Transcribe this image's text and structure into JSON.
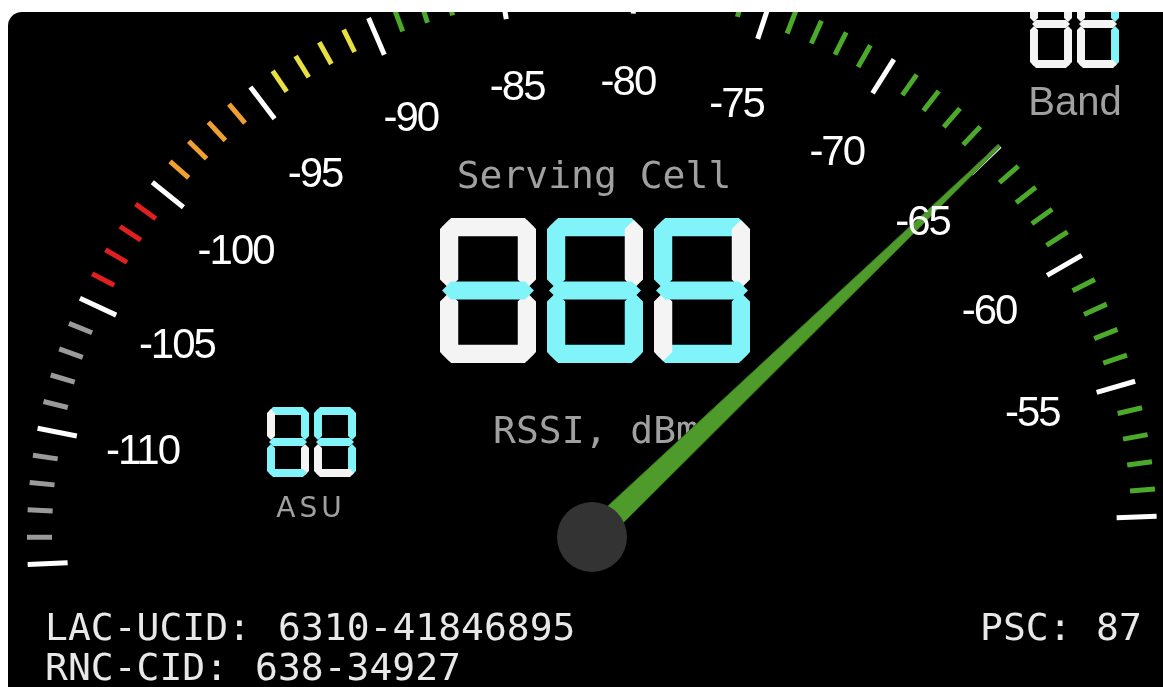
{
  "gauge": {
    "scale_labels": [
      "-110",
      "-105",
      "-100",
      "-95",
      "-90",
      "-85",
      "-80",
      "-75",
      "-70",
      "-65",
      "-60",
      "-55"
    ],
    "needle": {
      "level": 0.769
    }
  },
  "serving_cell": {
    "title": "Serving Cell",
    "digits": [
      {
        "segments": {
          "a": false,
          "b": false,
          "c": false,
          "d": false,
          "e": false,
          "f": false,
          "g": true
        }
      },
      {
        "segments": {
          "a": true,
          "b": false,
          "c": true,
          "d": true,
          "e": true,
          "f": true,
          "g": true
        }
      },
      {
        "segments": {
          "a": true,
          "b": false,
          "c": true,
          "d": true,
          "e": false,
          "f": true,
          "g": true
        }
      }
    ],
    "unit": "RSSI, dBm"
  },
  "asu": {
    "digits": [
      {
        "segments": {
          "a": true,
          "b": true,
          "c": false,
          "d": true,
          "e": true,
          "f": false,
          "g": true
        }
      },
      {
        "segments": {
          "a": true,
          "b": true,
          "c": true,
          "d": false,
          "e": false,
          "f": true,
          "g": true
        }
      }
    ],
    "label": "ASU"
  },
  "band": {
    "digits": [
      {
        "segments": {
          "b": false,
          "c": false,
          "d": false,
          "e": false,
          "f": false,
          "g": false
        }
      },
      {
        "segments": {
          "b": true,
          "c": true,
          "d": false,
          "e": false,
          "f": false,
          "g": false
        }
      }
    ],
    "label": "Band"
  },
  "cell_info": [
    {
      "label": "LAC-UCID:",
      "value": "6310-41846895"
    },
    {
      "label": "RNC-CID:",
      "value": "638-34927"
    },
    {
      "label": "PSC:",
      "value": "87"
    }
  ]
}
